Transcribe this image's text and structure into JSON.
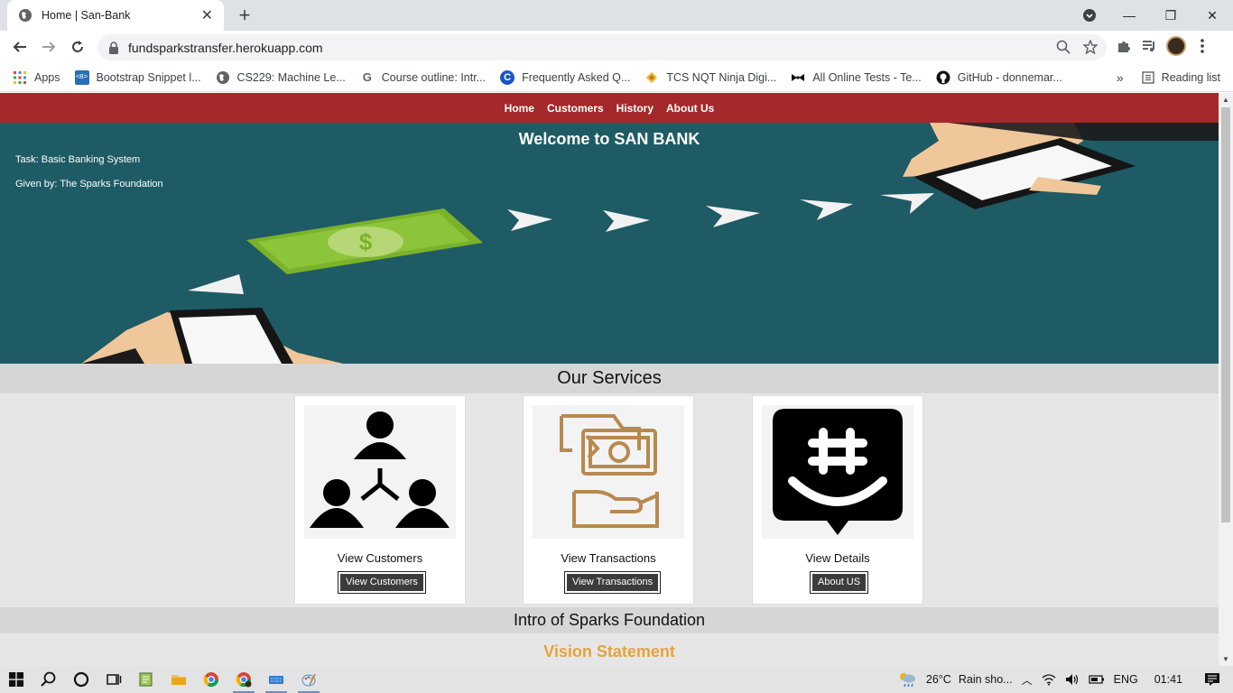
{
  "browser": {
    "tab_title": "Home | San-Bank",
    "url": "fundsparkstransfer.herokuapp.com",
    "bookmarks": [
      {
        "label": "Apps",
        "icon": "apps-grid-icon"
      },
      {
        "label": "Bootstrap Snippet l...",
        "icon": "bootstrap-icon"
      },
      {
        "label": "CS229: Machine Le...",
        "icon": "globe-icon"
      },
      {
        "label": "Course outline: Intr...",
        "icon": "google-icon"
      },
      {
        "label": "Frequently Asked Q...",
        "icon": "c-icon"
      },
      {
        "label": "TCS NQT Ninja Digi...",
        "icon": "tcs-icon"
      },
      {
        "label": "All Online Tests - Te...",
        "icon": "bowtie-icon"
      },
      {
        "label": "GitHub - donnemar...",
        "icon": "github-icon"
      }
    ],
    "more_bookmarks": "»",
    "reading_list": "Reading list"
  },
  "nav": {
    "items": [
      "Home",
      "Customers",
      "History",
      "About Us"
    ]
  },
  "hero": {
    "title": "Welcome to SAN BANK",
    "task": "Task: Basic Banking System",
    "given_by": "Given by: The Sparks Foundation"
  },
  "services": {
    "heading": "Our Services",
    "cards": [
      {
        "title": "View Customers",
        "button": "View Customers",
        "icon": "customers-network-icon"
      },
      {
        "title": "View Transactions",
        "button": "View Transactions",
        "icon": "money-transfer-icon"
      },
      {
        "title": "View Details",
        "button": "About US",
        "icon": "chat-hashtag-icon"
      }
    ]
  },
  "intro": {
    "heading": "Intro of Sparks Foundation",
    "vision": "Vision Statement"
  },
  "taskbar": {
    "weather_temp": "26°C",
    "weather_text": "Rain sho...",
    "language": "ENG",
    "time": "01:41"
  },
  "colors": {
    "nav_bg": "#a5282a",
    "hero_bg": "#1e5b65",
    "vision": "#e6a33b",
    "money_icon": "#b8894f"
  }
}
